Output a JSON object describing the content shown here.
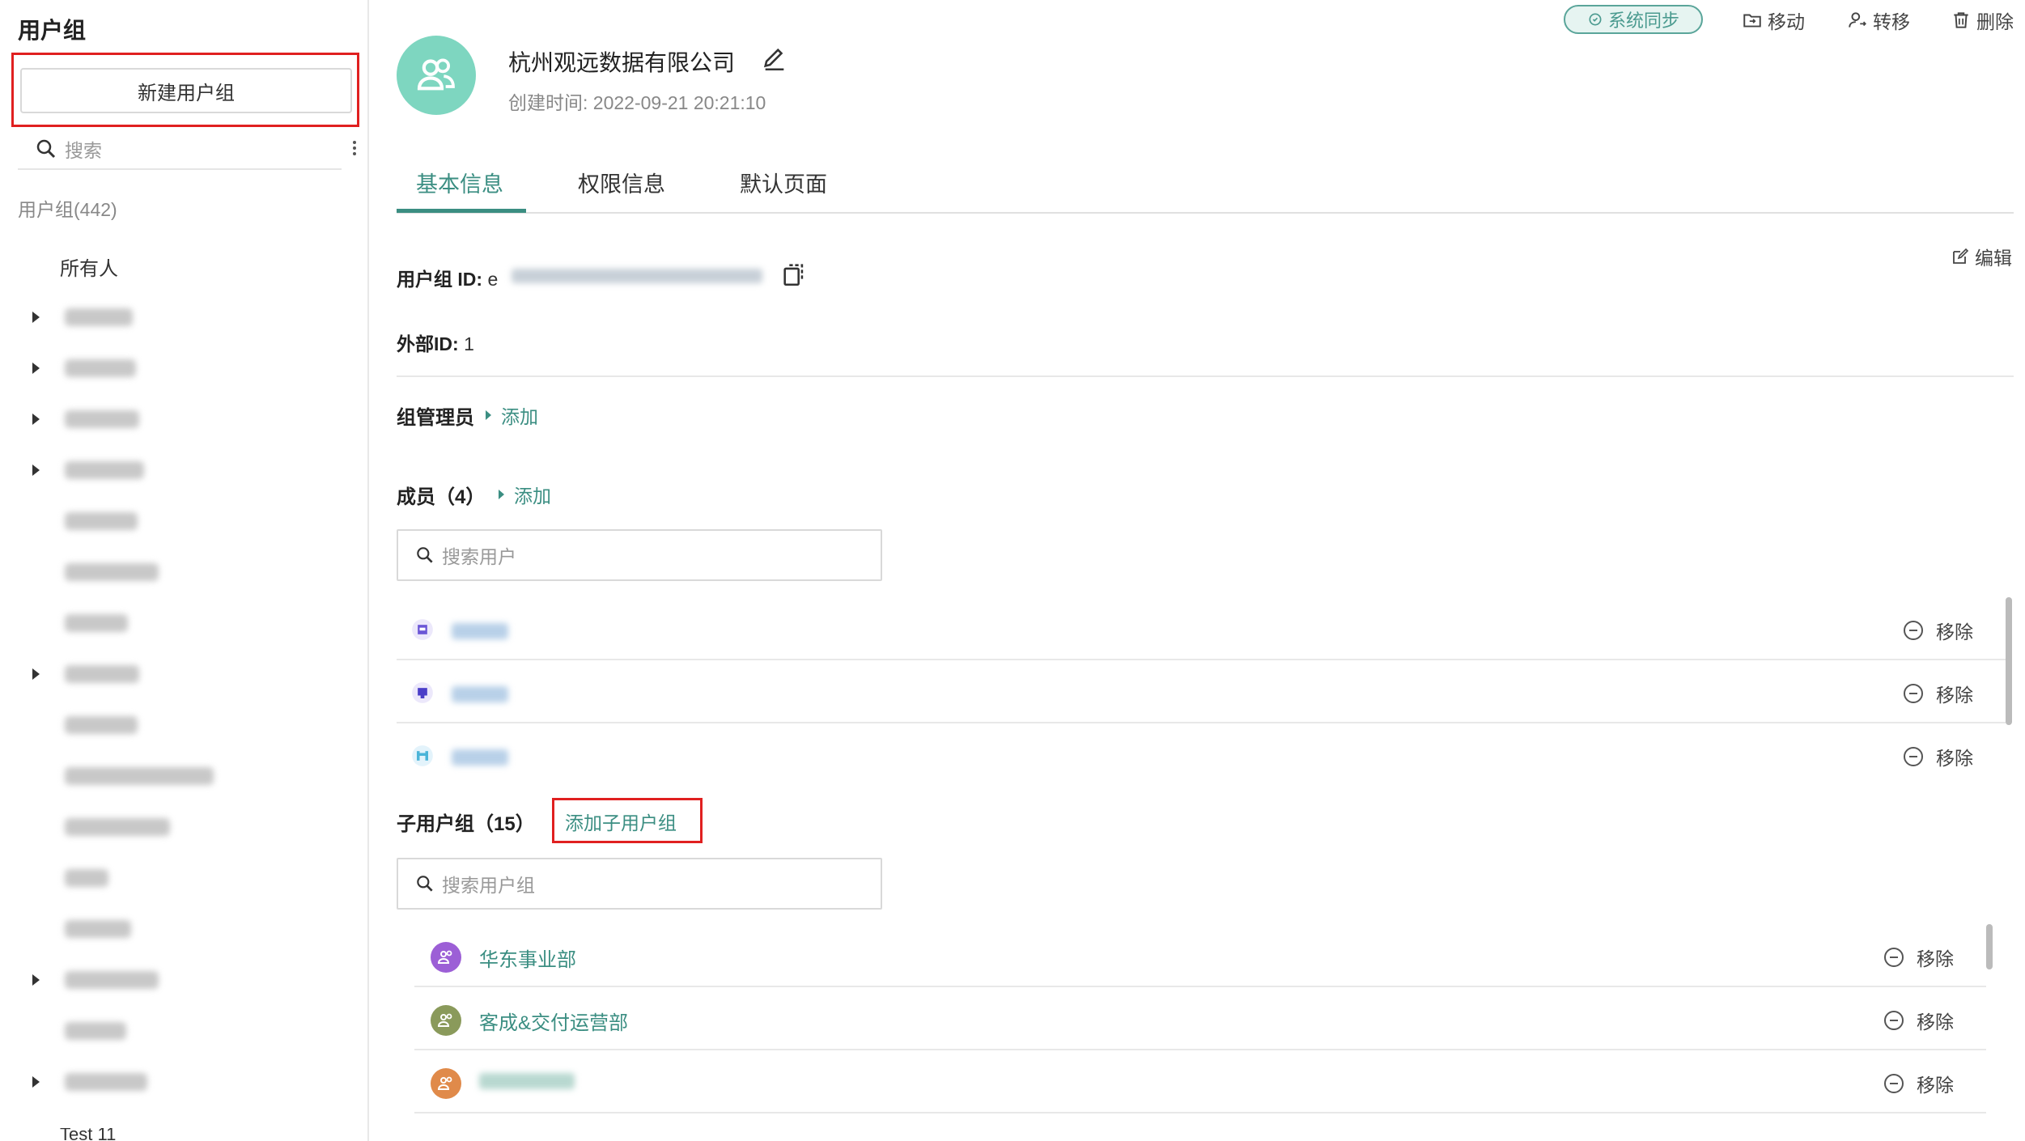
{
  "sidebar": {
    "title": "用户组",
    "new_group_label": "新建用户组",
    "search_placeholder": "搜索",
    "group_count": "用户组(442)",
    "all_label": "所有人",
    "truncated_bottom_label": "Test 11"
  },
  "header": {
    "company_name": "杭州观远数据有限公司",
    "created_label": "创建时间:",
    "created_time": "2022-09-21 20:21:10",
    "sync_badge": "系统同步",
    "actions": {
      "move": "移动",
      "transfer": "转移",
      "delete": "删除"
    }
  },
  "tabs": [
    {
      "label": "基本信息",
      "active": true
    },
    {
      "label": "权限信息",
      "active": false
    },
    {
      "label": "默认页面",
      "active": false
    }
  ],
  "basic": {
    "edit_label": "编辑",
    "group_id_label": "用户组 ID:",
    "group_id_prefix": "e",
    "external_id_label": "外部ID:",
    "external_id_value": "1"
  },
  "admins": {
    "title": "组管理员",
    "add_label": "添加"
  },
  "members": {
    "title": "成员（4）",
    "add_label": "添加",
    "search_placeholder": "搜索用户",
    "remove_label": "移除"
  },
  "subgroups": {
    "title": "子用户组（15）",
    "add_label": "添加子用户组",
    "search_placeholder": "搜索用户组",
    "remove_label": "移除",
    "items": [
      {
        "name": "华东事业部",
        "color": "#9c5fd6"
      },
      {
        "name": "客成&交付运营部",
        "color": "#8a9a5b"
      },
      {
        "name": "",
        "color": "#e08a4a"
      }
    ]
  },
  "colors": {
    "accent": "#3b8e82",
    "highlight_box": "#e02020",
    "avatar_bg": "#7ed6c0"
  }
}
